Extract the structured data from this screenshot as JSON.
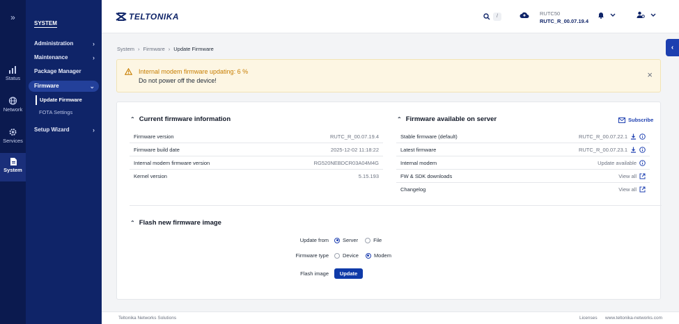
{
  "rail": {
    "toggle_icon": "double-chevron-right-icon",
    "items": [
      {
        "label": "Status",
        "icon": "bar-chart-icon"
      },
      {
        "label": "Network",
        "icon": "globe-icon"
      },
      {
        "label": "Services",
        "icon": "gear-icon"
      },
      {
        "label": "System",
        "icon": "document-icon"
      }
    ]
  },
  "submenu": {
    "title": "SYSTEM",
    "items": [
      {
        "label": "Administration"
      },
      {
        "label": "Maintenance"
      },
      {
        "label": "Package Manager"
      },
      {
        "label": "Firmware"
      },
      {
        "label": "Setup Wizard"
      }
    ],
    "firmware_children": [
      {
        "label": "Update Firmware"
      },
      {
        "label": "FOTA Settings"
      }
    ]
  },
  "header": {
    "logo": "TELTONIKA",
    "search_shortcut": "/",
    "device_name": "RUTC50",
    "device_firmware": "RUTC_R_00.07.19.4"
  },
  "breadcrumb": [
    "System",
    "Firmware",
    "Update Firmware"
  ],
  "alert": {
    "title": "Internal modem firmware updating: 6 %",
    "message": "Do not power off the device!"
  },
  "current": {
    "heading": "Current firmware information",
    "rows": [
      {
        "label": "Firmware version",
        "value": "RUTC_R_00.07.19.4"
      },
      {
        "label": "Firmware build date",
        "value": "2025-12-02 11:18:22"
      },
      {
        "label": "Internal modem firmware version",
        "value": "RG520NEBDCR03A04M4G"
      },
      {
        "label": "Kernel version",
        "value": "5.15.193"
      }
    ]
  },
  "server": {
    "heading": "Firmware available on server",
    "subscribe": "Subscribe",
    "rows": [
      {
        "label": "Stable firmware (default)",
        "value": "RUTC_R_00.07.22.1"
      },
      {
        "label": "Latest firmware",
        "value": "RUTC_R_00.07.23.1"
      },
      {
        "label": "Internal modem",
        "value": "Update available"
      },
      {
        "label": "FW & SDK downloads",
        "value": "View all"
      },
      {
        "label": "Changelog",
        "value": "View all"
      }
    ]
  },
  "flash": {
    "heading": "Flash new firmware image",
    "update_from_label": "Update from",
    "update_from_options": [
      "Server",
      "File"
    ],
    "update_from_selected": "Server",
    "type_label": "Firmware type",
    "type_options": [
      "Device",
      "Modem"
    ],
    "type_selected": "Modem",
    "flash_label": "Flash image",
    "button": "Update"
  },
  "footer": {
    "company": "Teltonika Networks Solutions",
    "licenses": "Licenses",
    "site": "www.teltonika-networks.com"
  },
  "colors": {
    "primary": "#0f3aa8",
    "sidebar": "#0f2468",
    "rail": "#0b1a4f",
    "warning": "#c77d00"
  }
}
